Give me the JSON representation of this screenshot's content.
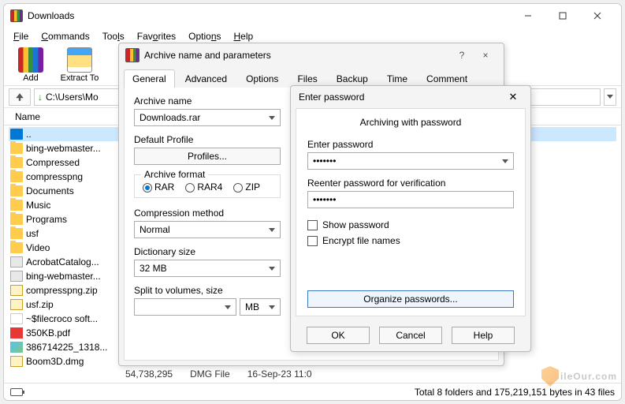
{
  "window": {
    "title": "Downloads",
    "menus": [
      "File",
      "Commands",
      "Tools",
      "Favorites",
      "Options",
      "Help"
    ],
    "tools": [
      {
        "label": "Add",
        "icon": "books-icon"
      },
      {
        "label": "Extract To",
        "icon": "extract-icon"
      }
    ],
    "path": "C:\\Users\\Mo",
    "col_name": "Name",
    "files": [
      {
        "icon": "drive",
        "name": "..",
        "sel": true
      },
      {
        "icon": "folder",
        "name": "bing-webmaster..."
      },
      {
        "icon": "folder",
        "name": "Compressed"
      },
      {
        "icon": "folder",
        "name": "compresspng"
      },
      {
        "icon": "folder",
        "name": "Documents"
      },
      {
        "icon": "folder",
        "name": "Music"
      },
      {
        "icon": "folder",
        "name": "Programs"
      },
      {
        "icon": "folder",
        "name": "usf"
      },
      {
        "icon": "folder",
        "name": "Video"
      },
      {
        "icon": "xml",
        "name": "AcrobatCatalog..."
      },
      {
        "icon": "xml",
        "name": "bing-webmaster..."
      },
      {
        "icon": "zip",
        "name": "compresspng.zip"
      },
      {
        "icon": "zip",
        "name": "usf.zip"
      },
      {
        "icon": "txt",
        "name": "~$filecroco soft..."
      },
      {
        "icon": "pdf",
        "name": "350KB.pdf"
      },
      {
        "icon": "img",
        "name": "386714225_1318..."
      },
      {
        "icon": "zip",
        "name": "Boom3D.dmg"
      }
    ],
    "extra_row": {
      "size": "54,738,295",
      "type": "DMG File",
      "date": "16-Sep-23 11:0"
    },
    "status": "Total 8 folders and 175,219,151 bytes in 43 files"
  },
  "dialog1": {
    "title": "Archive name and parameters",
    "help_symbol": "?",
    "close_symbol": "×",
    "tabs": [
      "General",
      "Advanced",
      "Options",
      "Files",
      "Backup",
      "Time",
      "Comment"
    ],
    "archive_name_label": "Archive name",
    "archive_name_value": "Downloads.rar",
    "default_profile_label": "Default Profile",
    "profiles_btn": "Profiles...",
    "format_legend": "Archive format",
    "formats": [
      "RAR",
      "RAR4",
      "ZIP"
    ],
    "compression_label": "Compression method",
    "compression_value": "Normal",
    "dict_label": "Dictionary size",
    "dict_value": "32 MB",
    "split_label": "Split to volumes, size",
    "split_value": "",
    "split_unit": "MB"
  },
  "dialog2": {
    "title": "Enter password",
    "close_symbol": "✕",
    "subtitle": "Archiving with password",
    "enter_label": "Enter password",
    "enter_value": "•••••••",
    "reenter_label": "Reenter password for verification",
    "reenter_value": "•••••••",
    "show_label": "Show password",
    "encrypt_label": "Encrypt file names",
    "organize_btn": "Organize passwords...",
    "ok": "OK",
    "cancel": "Cancel",
    "help": "Help"
  },
  "watermark": "ileOur.com"
}
